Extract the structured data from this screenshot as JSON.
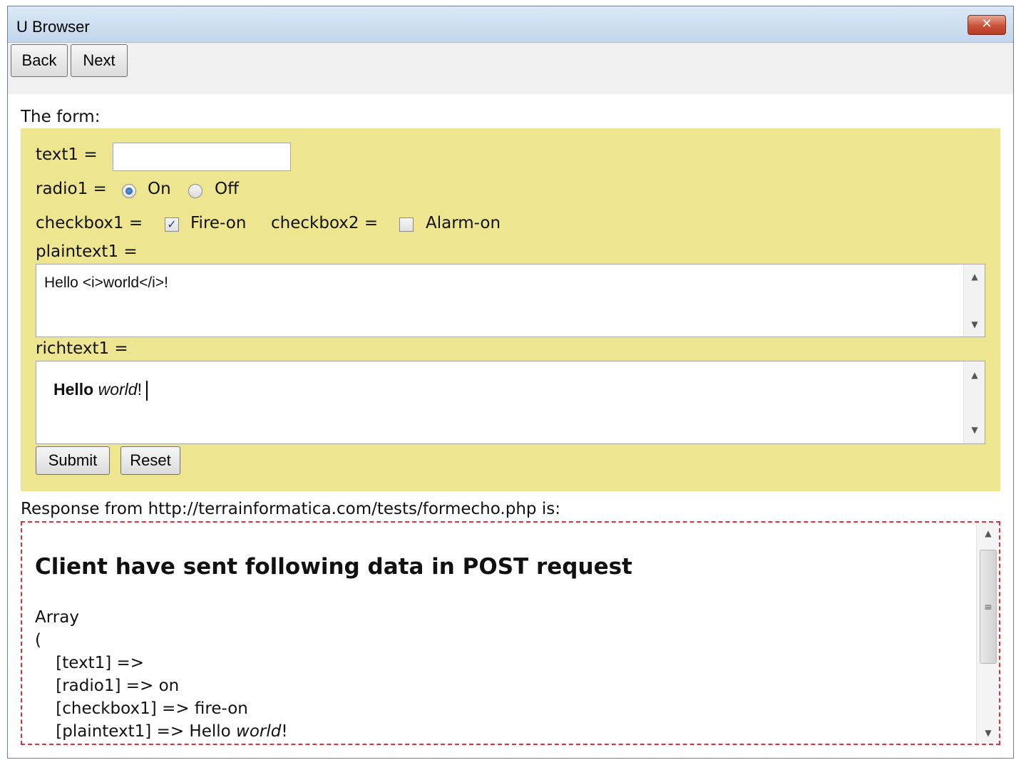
{
  "window": {
    "title": "U Browser",
    "close_label": "✕"
  },
  "toolbar": {
    "back_label": "Back",
    "next_label": "Next"
  },
  "form": {
    "caption": "The form:",
    "text1_label": "text1 =",
    "text1_value": "",
    "radio1_label": "radio1 =",
    "radio1_on_label": "On",
    "radio1_off_label": "Off",
    "radio1_selected": "On",
    "checkbox1_label": "checkbox1 =",
    "checkbox1_option": "Fire-on",
    "checkbox1_checked": true,
    "checkbox2_label": "checkbox2 =",
    "checkbox2_option": "Alarm-on",
    "checkbox2_checked": false,
    "plaintext1_label": "plaintext1 =",
    "plaintext1_value": "Hello <i>world</i>!",
    "richtext1_label": "richtext1 =",
    "richtext1_bold": "Hello",
    "richtext1_italic": "world",
    "richtext1_tail": "!",
    "submit_label": "Submit",
    "reset_label": "Reset"
  },
  "response": {
    "label": "Response from http://terrainformatica.com/tests/formecho.php is:",
    "heading": "Client have sent following data in POST request",
    "lines": [
      "Array",
      "(",
      "    [text1] =>",
      "    [radio1] => on",
      "    [checkbox1] => fire-on"
    ],
    "last_line_prefix": "    [plaintext1] => Hello ",
    "last_line_italic": "world",
    "last_line_suffix": "!"
  }
}
